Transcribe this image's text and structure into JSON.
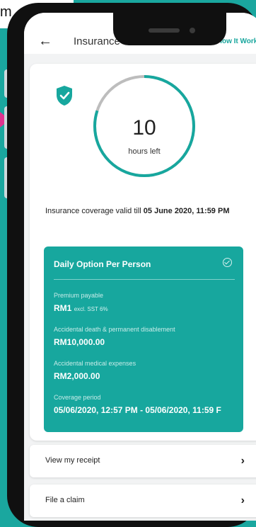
{
  "overlay": {
    "corner_text": "m"
  },
  "header": {
    "title": "Insurance",
    "how_link": "How It Works?"
  },
  "timer": {
    "value": "10",
    "label": "hours left",
    "progress": 0.8
  },
  "coverage": {
    "valid_prefix": "Insurance coverage valid till ",
    "valid_date": "05 June 2020, 11:59 PM"
  },
  "plan": {
    "title": "Daily Option Per Person",
    "fields": [
      {
        "label": "Premium payable",
        "value": "RM1",
        "note": "excl. SST 6%"
      },
      {
        "label": "Accidental death & permanent disablement",
        "value": "RM10,000.00"
      },
      {
        "label": "Accidental medical expenses",
        "value": "RM2,000.00"
      },
      {
        "label": "Coverage period",
        "value": "05/06/2020, 12:57 PM - 05/06/2020, 11:59 F"
      }
    ]
  },
  "actions": {
    "receipt": "View my receipt",
    "claim": "File a claim"
  },
  "colors": {
    "accent": "#17a79e",
    "background": "#1aa79f",
    "arrow": "#e0338f"
  }
}
